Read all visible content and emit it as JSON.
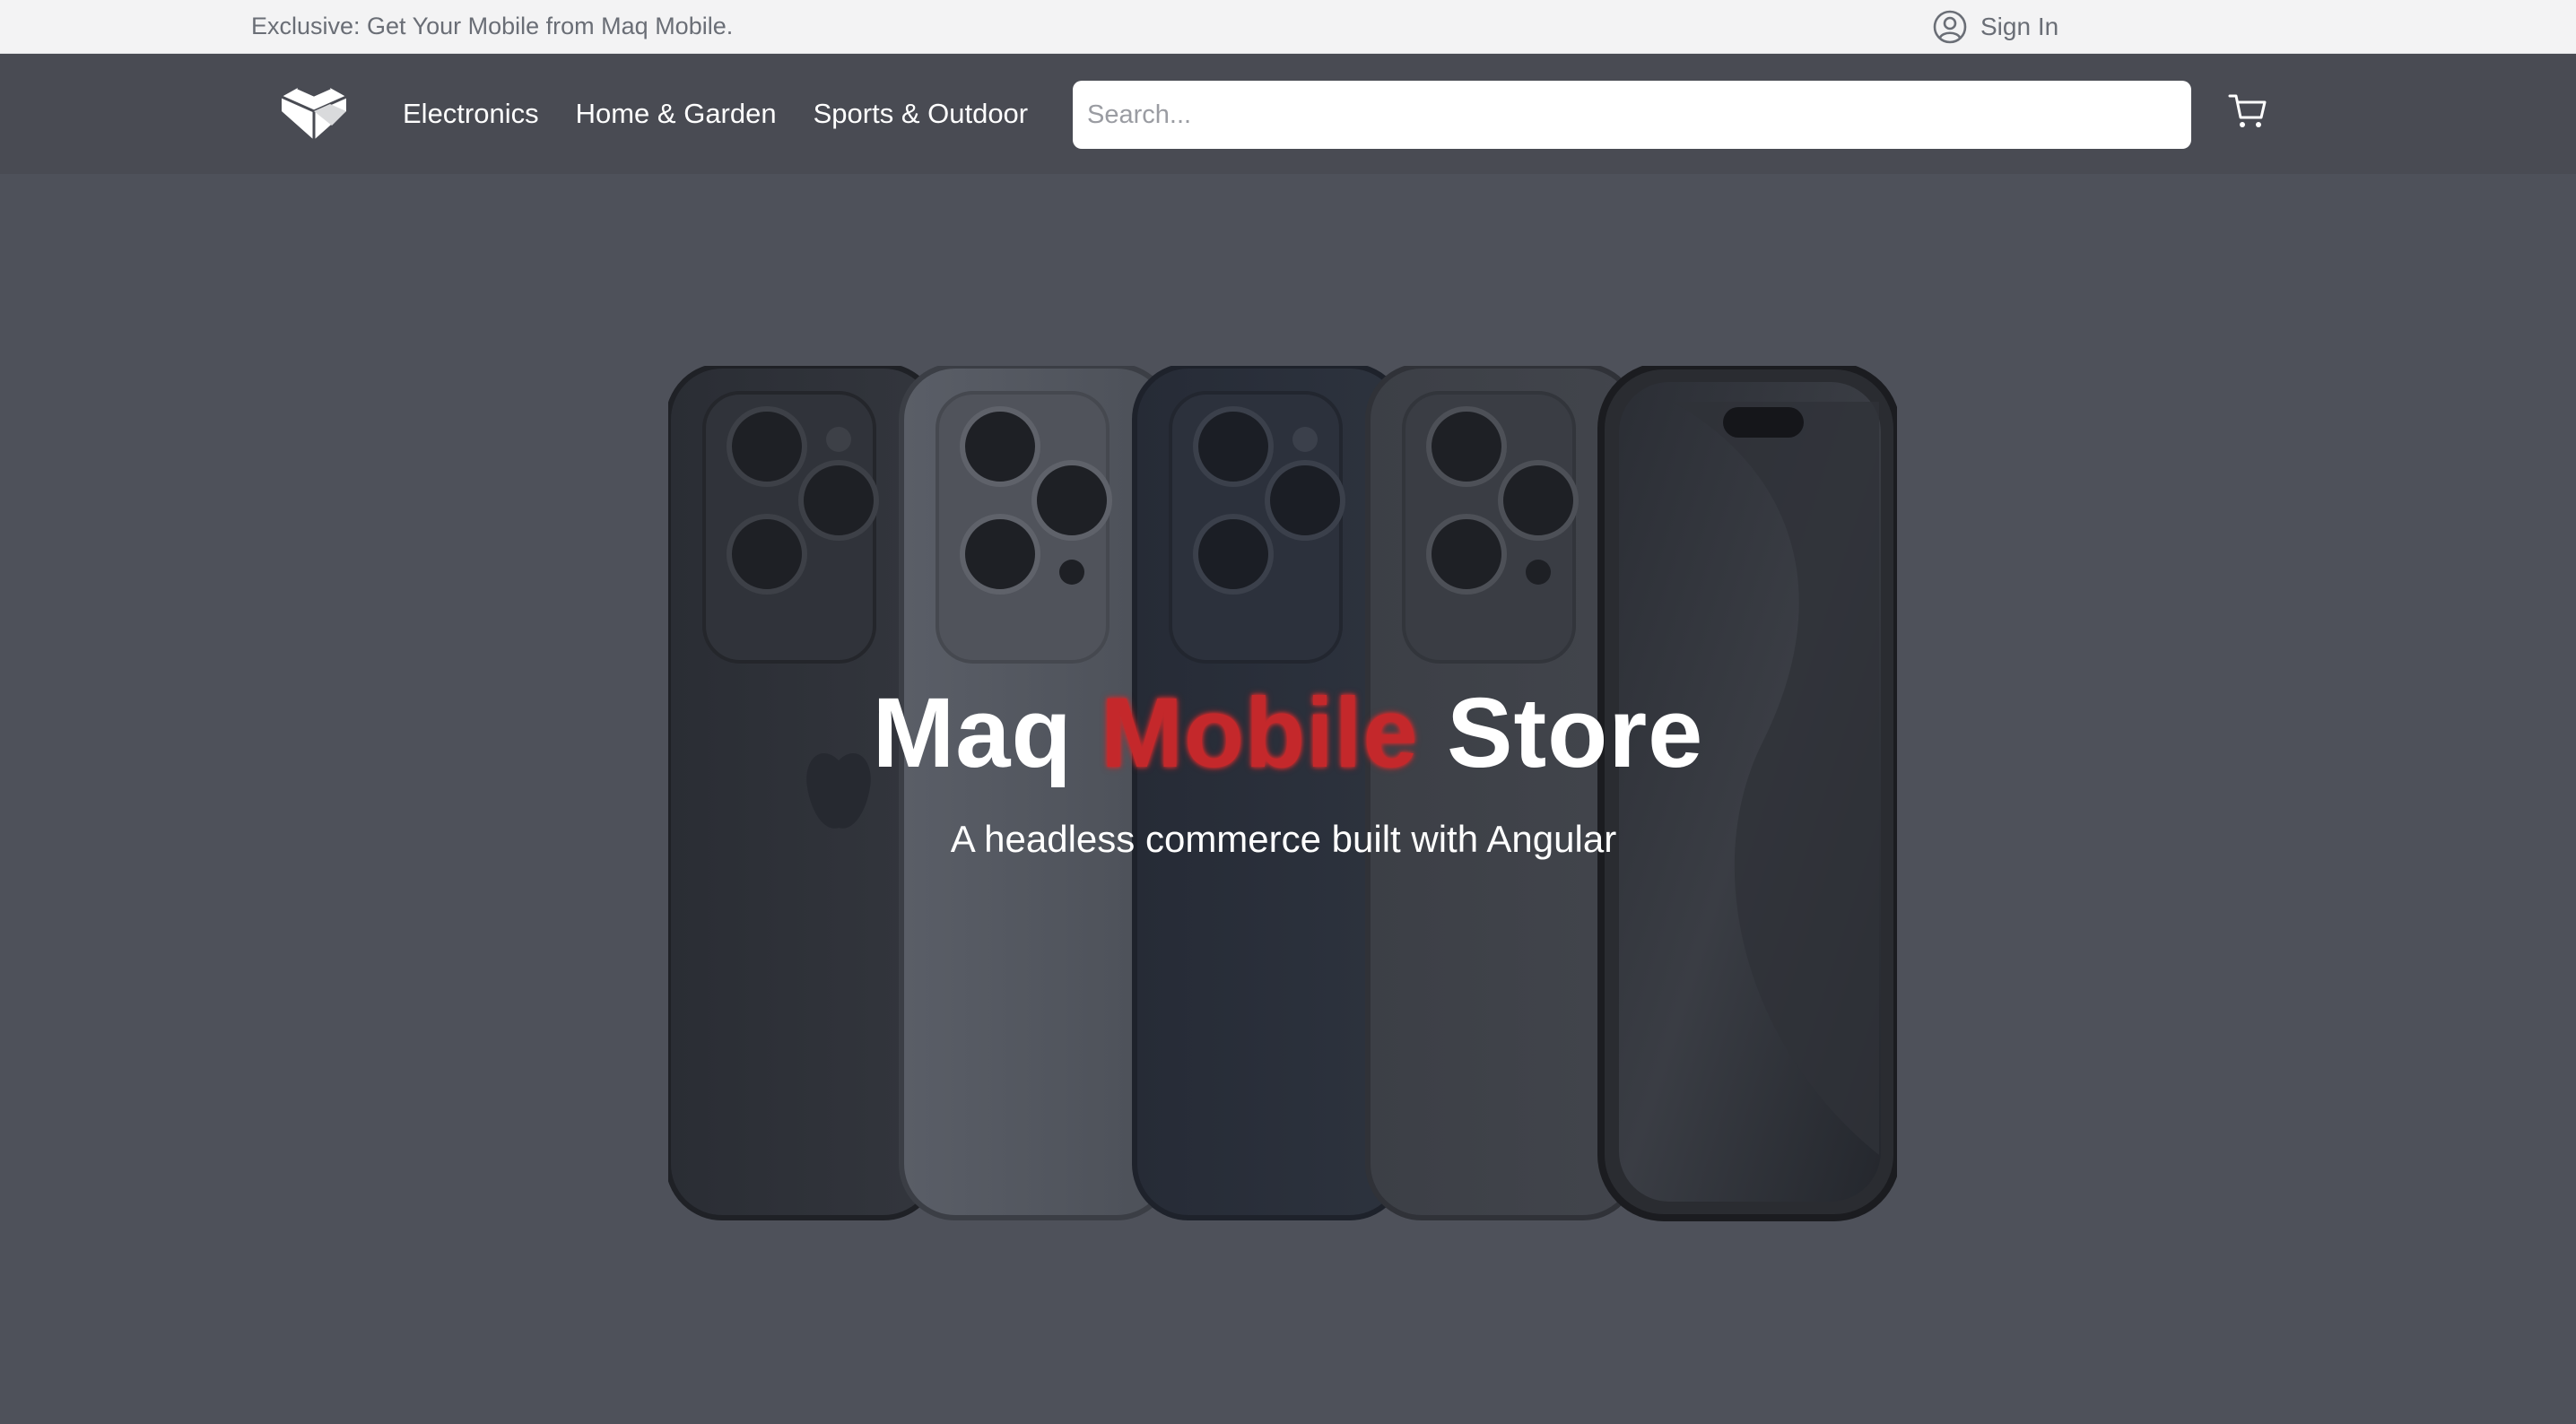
{
  "topbar": {
    "announcement": "Exclusive: Get Your Mobile from Maq Mobile.",
    "signin_label": "Sign In",
    "signin_icon": "user-circle-icon"
  },
  "header": {
    "logo_icon": "heart-cube-logo-icon",
    "nav": [
      {
        "label": "Electronics"
      },
      {
        "label": "Home & Garden"
      },
      {
        "label": "Sports & Outdoor"
      }
    ],
    "search_placeholder": "Search...",
    "cart_icon": "cart-icon"
  },
  "hero": {
    "title_part1": "Maq",
    "title_accent": "Mobile",
    "title_part2": "Store",
    "subtitle": "A headless commerce built with Angular",
    "image": "smartphones-lineup-image"
  },
  "colors": {
    "topbar_bg": "#f3f3f4",
    "header_bg": "#494b53",
    "hero_bg": "#4e515a",
    "accent": "#c4282b"
  }
}
